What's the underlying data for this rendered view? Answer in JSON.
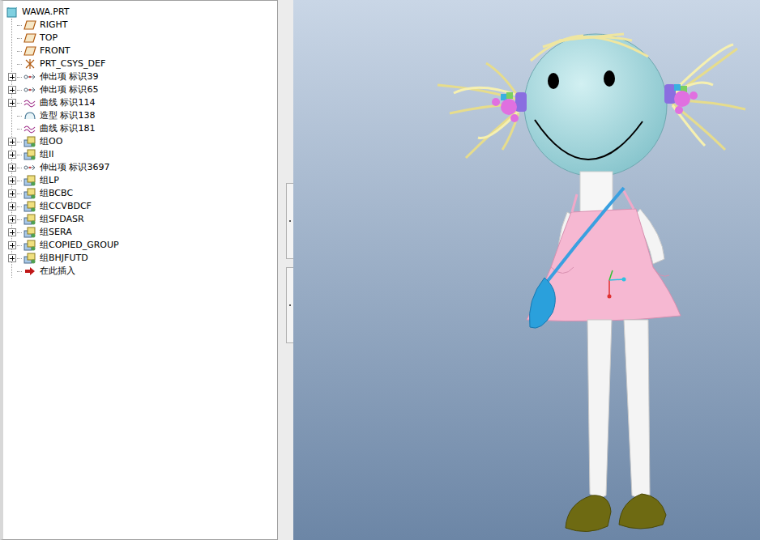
{
  "model_tree": {
    "root": "WAWA.PRT",
    "items": [
      {
        "label": "RIGHT",
        "kind": "plane",
        "expandable": false,
        "expanded": false
      },
      {
        "label": "TOP",
        "kind": "plane",
        "expandable": false,
        "expanded": false
      },
      {
        "label": "FRONT",
        "kind": "plane",
        "expandable": false,
        "expanded": false
      },
      {
        "label": "PRT_CSYS_DEF",
        "kind": "csys",
        "expandable": false,
        "expanded": false
      },
      {
        "label": "伸出项 标识39",
        "kind": "protrusion",
        "expandable": true,
        "expanded": false
      },
      {
        "label": "伸出项 标识65",
        "kind": "protrusion",
        "expandable": true,
        "expanded": false
      },
      {
        "label": "曲线 标识114",
        "kind": "curve",
        "expandable": true,
        "expanded": false
      },
      {
        "label": "造型 标识138",
        "kind": "style",
        "expandable": false,
        "expanded": false
      },
      {
        "label": "曲线 标识181",
        "kind": "curve",
        "expandable": false,
        "expanded": false
      },
      {
        "label": "组OO",
        "kind": "group",
        "expandable": true,
        "expanded": false
      },
      {
        "label": "组II",
        "kind": "group",
        "expandable": true,
        "expanded": false
      },
      {
        "label": "伸出项 标识3697",
        "kind": "protrusion",
        "expandable": true,
        "expanded": false
      },
      {
        "label": "组LP",
        "kind": "group",
        "expandable": true,
        "expanded": false
      },
      {
        "label": "组BCBC",
        "kind": "group",
        "expandable": true,
        "expanded": false
      },
      {
        "label": "组CCVBDCF",
        "kind": "group",
        "expandable": true,
        "expanded": false
      },
      {
        "label": "组SFDASR",
        "kind": "group",
        "expandable": true,
        "expanded": false
      },
      {
        "label": "组SERA",
        "kind": "group",
        "expandable": true,
        "expanded": false
      },
      {
        "label": "组COPIED_GROUP",
        "kind": "group",
        "expandable": true,
        "expanded": false
      },
      {
        "label": "组BHJFUTD",
        "kind": "group",
        "expandable": true,
        "expanded": false
      },
      {
        "label": "在此插入",
        "kind": "insert",
        "expandable": false,
        "expanded": false
      }
    ]
  }
}
